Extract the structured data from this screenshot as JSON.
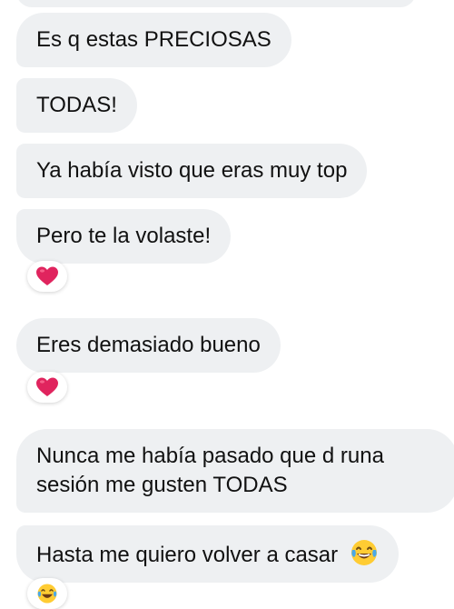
{
  "messages": [
    {
      "text": "Es q estas PRECIOSAS"
    },
    {
      "text": "TODAS!"
    },
    {
      "text": "Ya había visto que eras muy top"
    },
    {
      "text": "Pero te la volaste!",
      "reaction": "heart-icon"
    },
    {
      "text": "Eres demasiado bueno",
      "reaction": "heart-icon"
    },
    {
      "lines": [
        "Nunca me había pasado que d runa",
        "sesión me gusten TODAS"
      ]
    },
    {
      "text": "Hasta me quiero volver a casar",
      "trailing_emoji": "laughing-tears-icon",
      "reaction": "laughing-tears-icon"
    }
  ],
  "colors": {
    "bubble_bg": "#eef0f2",
    "text": "#111111",
    "heart": "#e0245e"
  }
}
